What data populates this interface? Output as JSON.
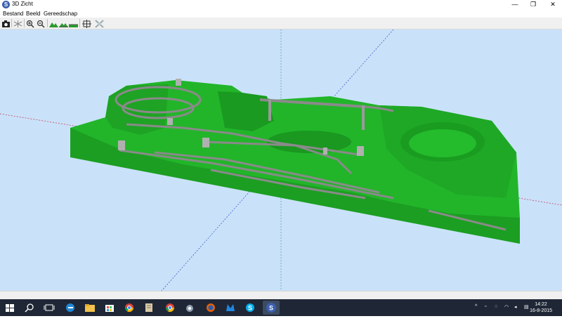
{
  "window": {
    "title": "3D Zicht",
    "minimize": "—",
    "maximize": "❐",
    "close": "✕"
  },
  "menu": {
    "items": [
      "Bestand",
      "Beeld",
      "Gereedschap"
    ]
  },
  "toolbar": {
    "buttons": [
      {
        "name": "camera-icon"
      },
      {
        "name": "axes-icon"
      },
      {
        "name": "zoom-in-icon"
      },
      {
        "name": "zoom-out-icon"
      },
      {
        "name": "terrain-icon"
      },
      {
        "name": "terrain-tracks-icon"
      },
      {
        "name": "terrain-flat-icon"
      },
      {
        "name": "fit-view-icon"
      },
      {
        "name": "tools-disabled-icon"
      }
    ]
  },
  "taskbar": {
    "clock_time": "14:22",
    "clock_date": "16-8-2015",
    "colors": {
      "background": "#1f2736",
      "viewport": "#c9e2f9",
      "terrain": "#22b52a",
      "track": "#808080"
    }
  }
}
